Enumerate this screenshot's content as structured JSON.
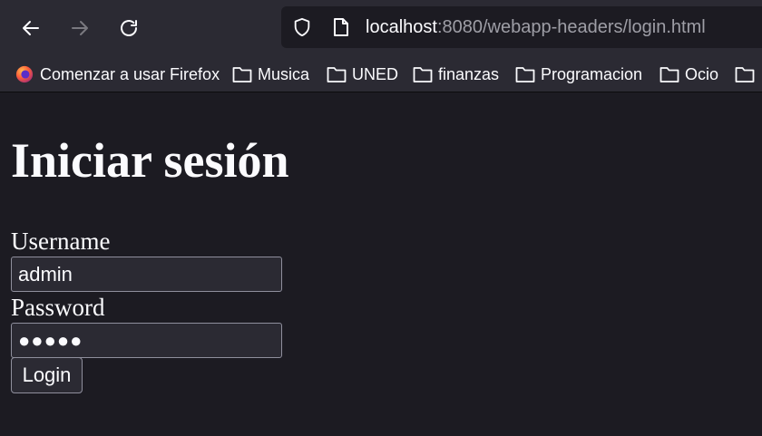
{
  "browser": {
    "url_host": "localhost",
    "url_rest": ":8080/webapp-headers/login.html"
  },
  "bookmarks": [
    {
      "label": "Comenzar a usar Firefox",
      "icon": "firefox-icon"
    },
    {
      "label": "Musica",
      "icon": "folder-icon"
    },
    {
      "label": "UNED",
      "icon": "folder-icon"
    },
    {
      "label": "finanzas",
      "icon": "folder-icon"
    },
    {
      "label": "Programacion",
      "icon": "folder-icon"
    },
    {
      "label": "Ocio",
      "icon": "folder-icon"
    }
  ],
  "page": {
    "title": "Iniciar sesión",
    "username_label": "Username",
    "username_value": "admin",
    "password_label": "Password",
    "password_value": "●●●●●",
    "login_label": "Login"
  },
  "colors": {
    "toolbar": "#2b2a33",
    "page_background": "#1c1b22",
    "text": "#fbfbfe",
    "url_dim": "#9e9ea6"
  }
}
